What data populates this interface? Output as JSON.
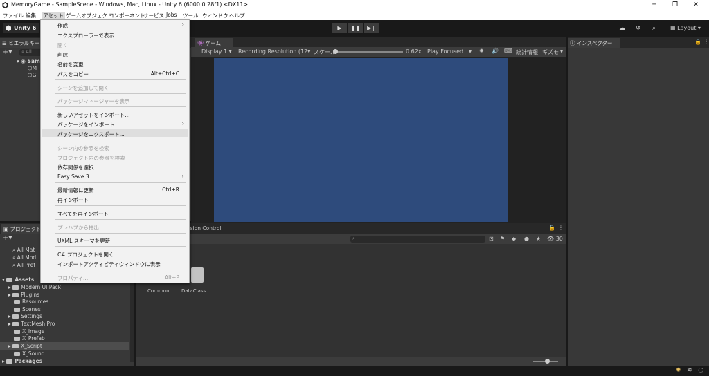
{
  "window": {
    "title": "MemoryGame - SampleScene - Windows, Mac, Linux - Unity 6 (6000.0.28f1) <DX11>"
  },
  "menubar": [
    "ファイル",
    "編集",
    "アセット",
    "ゲームオブジェクト",
    "コンポーネント",
    "サービス",
    "Jobs",
    "ツール",
    "ウィンドウ",
    "ヘルプ"
  ],
  "toolbar": {
    "account": "Unity 6",
    "layout": "Layout"
  },
  "hierarchy": {
    "tab": "ヒエラルキー",
    "search": "All",
    "scene": "Sam",
    "items": [
      "M",
      "G"
    ]
  },
  "game": {
    "tab": "ゲーム",
    "display": "Display 1",
    "resolution": "Recording Resolution (12",
    "scale_label": "スケール",
    "scale": "0.62x",
    "play": "Play Focused",
    "stats": "統計情報",
    "gizmos": "ギズモ",
    "viewport_color": "#2e4b7c"
  },
  "inspector": {
    "tab": "インスペクター"
  },
  "project": {
    "tab": "プロジェクト",
    "console_tab": "ersion Control",
    "count": "30",
    "favorites": [
      "All Mat",
      "All Mod",
      "All Pref"
    ],
    "assets_label": "Assets",
    "folders": [
      "Modern UI Pack",
      "Plugins",
      "Resources",
      "Scenes",
      "Settings",
      "TextMesh Pro",
      "X_Image",
      "X_Prefab",
      "X_Script",
      "X_Sound"
    ],
    "packages_label": "Packages",
    "grid": [
      "Common",
      "DataClass"
    ]
  },
  "asset_menu": {
    "items": [
      {
        "label": "作成",
        "arrow": true
      },
      {
        "label": "エクスプローラーで表示"
      },
      {
        "label": "開く",
        "disabled": true
      },
      {
        "label": "削除"
      },
      {
        "label": "名前を変更"
      },
      {
        "label": "パスをコピー",
        "shortcut": "Alt+Ctrl+C"
      },
      {
        "label": "シーンを追加して開く",
        "disabled": true
      },
      {
        "label": "パッケージマネージャーを表示",
        "disabled": true
      },
      {
        "label": "新しいアセットをインポート..."
      },
      {
        "label": "パッケージをインポート",
        "arrow": true
      },
      {
        "label": "パッケージをエクスポート..."
      },
      {
        "label": "シーン内の参照を検索",
        "disabled": true
      },
      {
        "label": "プロジェクト内の参照を検索",
        "disabled": true
      },
      {
        "label": "依存関係を選択"
      },
      {
        "label": "Easy Save 3",
        "arrow": true
      },
      {
        "label": "最新情報に更新",
        "shortcut": "Ctrl+R"
      },
      {
        "label": "再インポート"
      },
      {
        "label": "すべてを再インポート"
      },
      {
        "label": "プレハブから抽出",
        "disabled": true
      },
      {
        "label": "UXML スキーマを更新"
      },
      {
        "label": "C# プロジェクトを開く"
      },
      {
        "label": "インポートアクティビティウィンドウに表示"
      },
      {
        "label": "プロパティ...",
        "disabled": true,
        "shortcut": "Alt+P"
      }
    ]
  }
}
